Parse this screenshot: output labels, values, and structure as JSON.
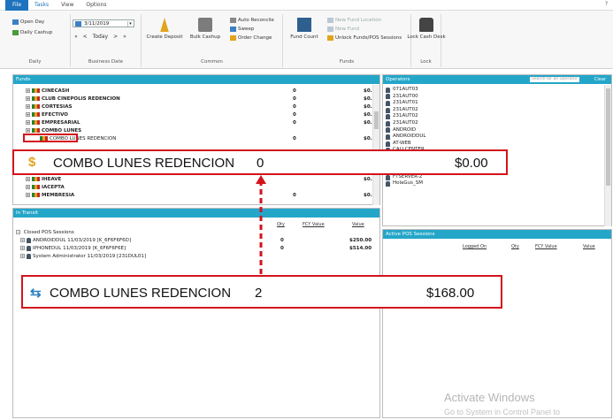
{
  "menu": {
    "file": "File",
    "tasks": "Tasks",
    "view": "View",
    "options": "Options",
    "help": "?"
  },
  "ribbon": {
    "daily": {
      "open_day": "Open Day",
      "daily_cashup": "Daily Cashup",
      "caption": "Daily"
    },
    "business_date": {
      "date": "3/11/2019",
      "prev_prev": "«",
      "prev": "<",
      "today": "Today",
      "next": ">",
      "next_next": "»",
      "caption": "Business Date"
    },
    "common": {
      "create_deposit": "Create Deposit",
      "bulk_cashup": "Bulk Cashup",
      "auto_reconcile": "Auto Reconcile",
      "sweep": "Sweep",
      "order_change": "Order Change",
      "caption": "Common"
    },
    "funds": {
      "fund_count": "Fund Count",
      "new_fund_location": "New Fund Location",
      "new_fund": "New Fund",
      "unlock": "Unlock Funds/POS Sessions",
      "caption": "Funds"
    },
    "lock": {
      "lock_cash_desk": "Lock Cash Desk",
      "caption": "Lock"
    }
  },
  "funds_panel": {
    "title": "Funds",
    "rows": [
      {
        "name": "CINECASH",
        "qty": "0",
        "value": "$0.00"
      },
      {
        "name": "CLUB CINEPOLIS REDENCION",
        "qty": "0",
        "value": "$0.00"
      },
      {
        "name": "CORTESIAS",
        "qty": "0",
        "value": "$0.00"
      },
      {
        "name": "EFECTIVO",
        "qty": "0",
        "value": "$0.00"
      },
      {
        "name": "EMPRESARIAL",
        "qty": "0",
        "value": "$0.00"
      },
      {
        "name": "COMBO LUNES",
        "qty": "",
        "value": ""
      },
      {
        "name": "COMBO LUNES REDENCION",
        "qty": "0",
        "value": "$0.00"
      }
    ],
    "rows_below": [
      {
        "name": "IHEAVE",
        "qty": "",
        "value": "$0.00"
      },
      {
        "name": "IACEPTA",
        "qty": "",
        "value": ""
      },
      {
        "name": "MEMBRESIA",
        "qty": "0",
        "value": "$0.00"
      }
    ]
  },
  "callout_funds": {
    "name": "COMBO LUNES REDENCION",
    "qty": "0",
    "value": "$0.00"
  },
  "operators_panel": {
    "title": "Operators",
    "search_placeholder": "Search for an Operator",
    "clear": "Clear",
    "items": [
      "071AUT03",
      "231AUT00",
      "231AUT01",
      "231AUT02",
      "231AUT02",
      "231AUT02",
      "ANDROID",
      "ANDROIDDUL",
      "AT-WEB",
      "CALLCENTER",
      "CALLCENTRE",
      "CMPMXT",
      "FACEBOOK2",
      "FTSERVER-2",
      "HolaGus_SM"
    ]
  },
  "in_transit_panel": {
    "title": "In Transit",
    "columns": {
      "qty": "Qty",
      "fcy": "FCY Value",
      "value": "Value"
    },
    "group": "Closed POS Sessions",
    "sessions": [
      {
        "name": "ANDROIDDUL 11/03/2019 [K_6F6F6F6D]",
        "qty": "0",
        "value": "$250.00"
      },
      {
        "name": "IPHONEDUL 11/03/2019 [K_6F6F6F6E]",
        "qty": "0",
        "value": "$514.00"
      },
      {
        "name": "System Administrator 11/03/2019 [231DUL01]",
        "qty": "",
        "value": ""
      }
    ]
  },
  "callout_transit": {
    "name": "COMBO LUNES REDENCION",
    "qty": "2",
    "value": "$168.00"
  },
  "active_pos_panel": {
    "title": "Active POS Sessions",
    "columns": {
      "logged_on": "Logged On",
      "qty": "Qty",
      "fcy": "FCY Value",
      "value": "Value"
    }
  },
  "watermark": {
    "line1": "Activate Windows",
    "line2": "Go to System in Control Panel to"
  },
  "colors": {
    "accent": "#24a6c9",
    "file_tab": "#1e73be",
    "highlight": "#d3131c"
  }
}
